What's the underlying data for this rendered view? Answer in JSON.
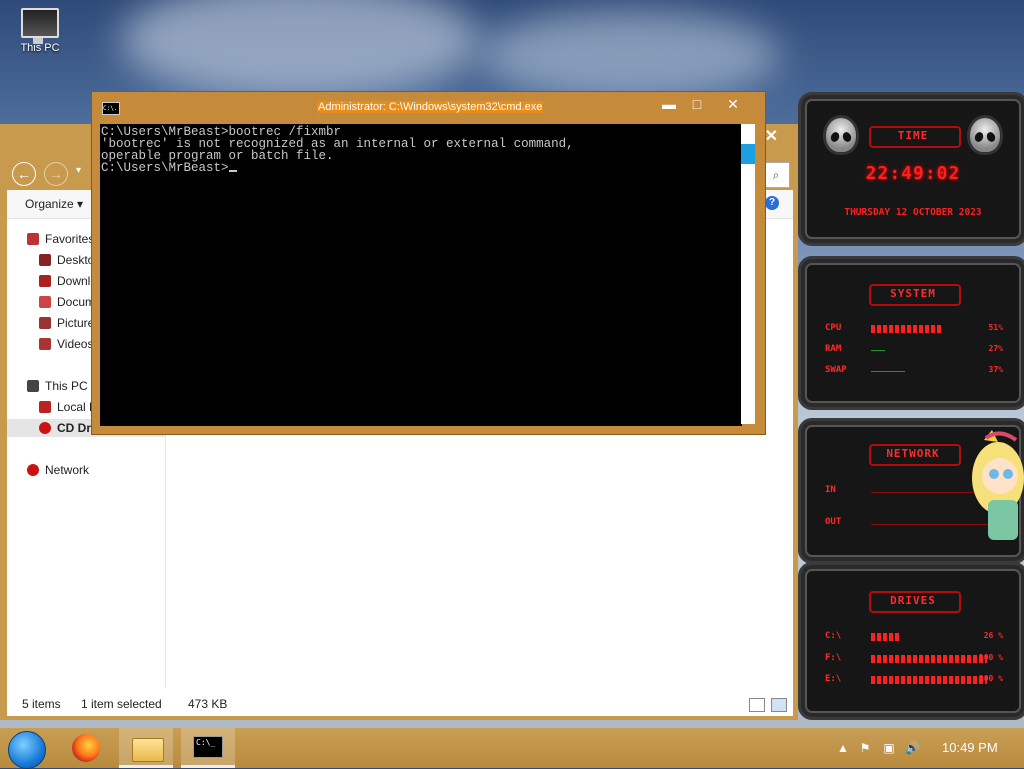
{
  "desktop": {
    "icons": [
      {
        "label": "This PC"
      }
    ]
  },
  "explorer": {
    "organize_label": "Organize ▾",
    "help_icon": "?",
    "nav_items": [
      {
        "label": "Favorites"
      },
      {
        "label": "Desktop"
      },
      {
        "label": "Downloads"
      },
      {
        "label": "Documents"
      },
      {
        "label": "Pictures"
      },
      {
        "label": "Videos"
      },
      {
        "label": "This PC"
      },
      {
        "label": "Local Disk (C:)"
      },
      {
        "label": "CD Drive (E:) CDRO"
      },
      {
        "label": "Network"
      }
    ],
    "status": {
      "items": "5 items",
      "selected": "1 item selected",
      "size": "473 KB"
    }
  },
  "cmd": {
    "title": "Administrator: C:\\Windows\\system32\\cmd.exe",
    "icon_text": "C:\\.",
    "lines": [
      "C:\\Users\\MrBeast>bootrec /fixmbr",
      "'bootrec' is not recognized as an internal or external command,",
      "operable program or batch file.",
      "",
      "C:\\Users\\MrBeast>"
    ],
    "buttons": {
      "minimize": "▬",
      "maximize": "□",
      "close": "✕"
    }
  },
  "gadgets": {
    "time": {
      "title": "TIME",
      "clock": "22:49:02",
      "date": "THURSDAY 12 OCTOBER 2023"
    },
    "system": {
      "title": "SYSTEM",
      "rows": [
        {
          "label": "CPU",
          "value": "51%",
          "fill": 0.51
        },
        {
          "label": "RAM",
          "value": "27%",
          "fill": 0.27
        },
        {
          "label": "SWAP",
          "value": "37%",
          "fill": 0.37
        }
      ]
    },
    "network": {
      "title": "NETWORK",
      "in_label": "IN",
      "out_label": "OUT"
    },
    "drives": {
      "title": "DRIVES",
      "rows": [
        {
          "label": "C:\\",
          "value": "26 %",
          "fill": 0.26
        },
        {
          "label": "F:\\",
          "value": "100 %",
          "fill": 1.0
        },
        {
          "label": "E:\\",
          "value": "100 %",
          "fill": 1.0
        }
      ]
    }
  },
  "taskbar": {
    "clock": "10:49 PM",
    "cmd_icon_text": "C:\\_"
  },
  "colors": {
    "accent_red": "#ff2a2a",
    "taskbar": "#c99f55",
    "cmd_title": "#e58e1b"
  }
}
